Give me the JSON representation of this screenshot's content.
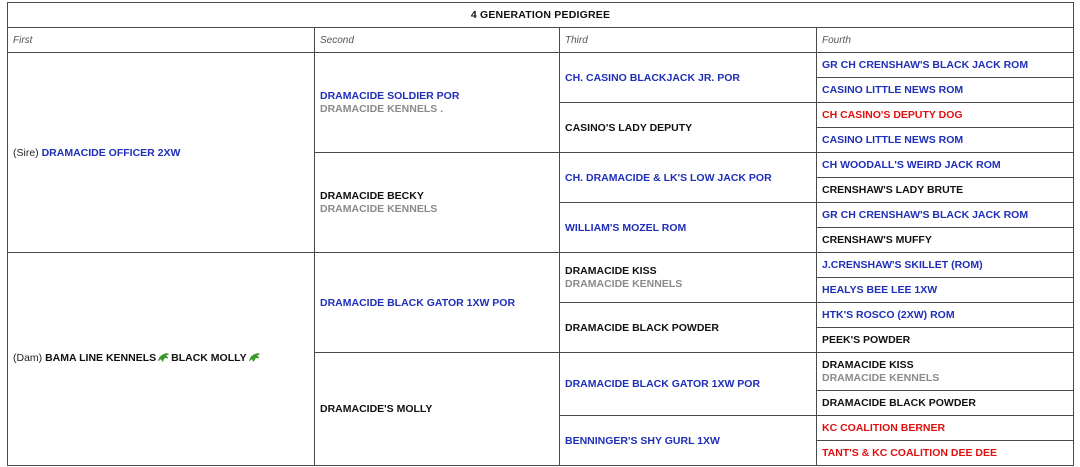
{
  "title": "4 GENERATION PEDIGREE",
  "columns": [
    "First",
    "Second",
    "Third",
    "Fourth"
  ],
  "icon_color": "#3a9a2a",
  "first": {
    "sire_prefix": "(Sire)",
    "sire_name": "DRAMACIDE OFFICER 2XW",
    "dam_prefix": "(Dam)",
    "dam_name_part1": "BAMA LINE KENNELS",
    "dam_name_part2": "BLACK MOLLY"
  },
  "second": [
    {
      "name": "DRAMACIDE SOLDIER POR",
      "kennel": "DRAMACIDE KENNELS ."
    },
    {
      "name": "DRAMACIDE BECKY",
      "kennel": "DRAMACIDE KENNELS"
    },
    {
      "name": "DRAMACIDE BLACK GATOR 1XW POR",
      "kennel": ""
    },
    {
      "name": "DRAMACIDE'S MOLLY",
      "kennel": ""
    }
  ],
  "third": [
    {
      "name": "CH. CASINO BLACKJACK JR. POR",
      "kennel": ""
    },
    {
      "name": "CASINO'S LADY DEPUTY",
      "kennel": ""
    },
    {
      "name": "CH. DRAMACIDE & LK'S LOW JACK POR",
      "kennel": ""
    },
    {
      "name": "WILLIAM'S MOZEL ROM",
      "kennel": ""
    },
    {
      "name": "DRAMACIDE KISS",
      "kennel": "DRAMACIDE KENNELS"
    },
    {
      "name": "DRAMACIDE BLACK POWDER",
      "kennel": ""
    },
    {
      "name": "DRAMACIDE BLACK GATOR 1XW POR",
      "kennel": ""
    },
    {
      "name": "BENNINGER'S SHY GURL 1XW",
      "kennel": ""
    }
  ],
  "fourth": [
    {
      "name": "GR CH CRENSHAW'S BLACK JACK ROM",
      "kennel": ""
    },
    {
      "name": "CASINO LITTLE NEWS ROM",
      "kennel": ""
    },
    {
      "name": "CH CASINO'S DEPUTY DOG",
      "kennel": ""
    },
    {
      "name": "CASINO LITTLE NEWS ROM",
      "kennel": ""
    },
    {
      "name": "CH WOODALL'S WEIRD JACK ROM",
      "kennel": ""
    },
    {
      "name": "CRENSHAW'S LADY BRUTE",
      "kennel": ""
    },
    {
      "name": "GR CH CRENSHAW'S BLACK JACK ROM",
      "kennel": ""
    },
    {
      "name": "CRENSHAW'S MUFFY",
      "kennel": ""
    },
    {
      "name": "J.CRENSHAW'S SKILLET (ROM)",
      "kennel": ""
    },
    {
      "name": "HEALYS BEE LEE 1XW",
      "kennel": ""
    },
    {
      "name": "HTK'S ROSCO (2XW) ROM",
      "kennel": ""
    },
    {
      "name": "PEEK'S POWDER",
      "kennel": ""
    },
    {
      "name": "DRAMACIDE KISS",
      "kennel": "DRAMACIDE KENNELS"
    },
    {
      "name": "DRAMACIDE BLACK POWDER",
      "kennel": ""
    },
    {
      "name": "KC COALITION BERNER",
      "kennel": ""
    },
    {
      "name": "TANT'S & KC COALITION DEE DEE",
      "kennel": ""
    }
  ]
}
